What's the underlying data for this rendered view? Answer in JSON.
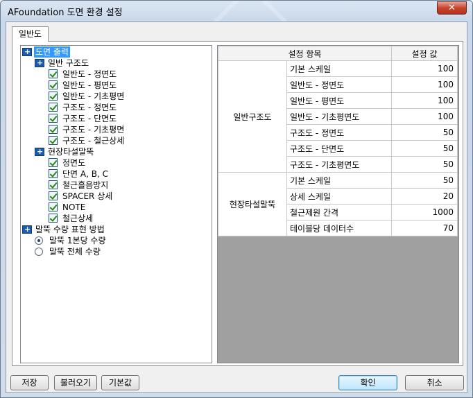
{
  "window": {
    "title": "AFoundation 도면 환경 설정",
    "close_label": "✕"
  },
  "tabs": [
    {
      "label": "일반도"
    }
  ],
  "tree": {
    "root": {
      "label": "도면 출력",
      "selected": true
    },
    "groups": [
      {
        "label": "일반 구조도",
        "items": [
          "일반도 - 정면도",
          "일반도 - 평면도",
          "일반도 - 기초평면",
          "구조도 - 정면도",
          "구조도 - 단면도",
          "구조도 - 기초평면",
          "구조도 - 철근상세"
        ]
      },
      {
        "label": "현장타설말뚝",
        "items": [
          "정면도",
          "단면 A, B, C",
          "철근흘음방지",
          "SPACER 상세",
          "NOTE",
          "철근상세"
        ]
      }
    ],
    "pile_group": {
      "label": "말뚝 수량 표현 방법",
      "options": [
        {
          "label": "말뚝 1본당 수량",
          "selected": true
        },
        {
          "label": "말뚝 전체 수량",
          "selected": false
        }
      ]
    }
  },
  "grid": {
    "headers": [
      "설정 항목",
      "설정 값"
    ],
    "groups": [
      {
        "name": "일반구조도",
        "rows": [
          {
            "item": "기본 스케일",
            "value": "100"
          },
          {
            "item": "일반도 - 정면도",
            "value": "100"
          },
          {
            "item": "일반도 - 평면도",
            "value": "100"
          },
          {
            "item": "일반도 - 기초평면도",
            "value": "100"
          },
          {
            "item": "구조도 - 정면도",
            "value": "50"
          },
          {
            "item": "구조도 - 단면도",
            "value": "50"
          },
          {
            "item": "구조도 - 기초평면도",
            "value": "50"
          }
        ]
      },
      {
        "name": "현장타설말뚝",
        "rows": [
          {
            "item": "기본 스케일",
            "value": "50"
          },
          {
            "item": "상세 스케일",
            "value": "20"
          },
          {
            "item": "철근제원 간격",
            "value": "1000"
          },
          {
            "item": "테이블당 데이터수",
            "value": "70"
          }
        ]
      }
    ]
  },
  "buttons": {
    "save": "저장",
    "load": "불러오기",
    "default": "기본값",
    "ok": "확인",
    "cancel": "취소"
  }
}
